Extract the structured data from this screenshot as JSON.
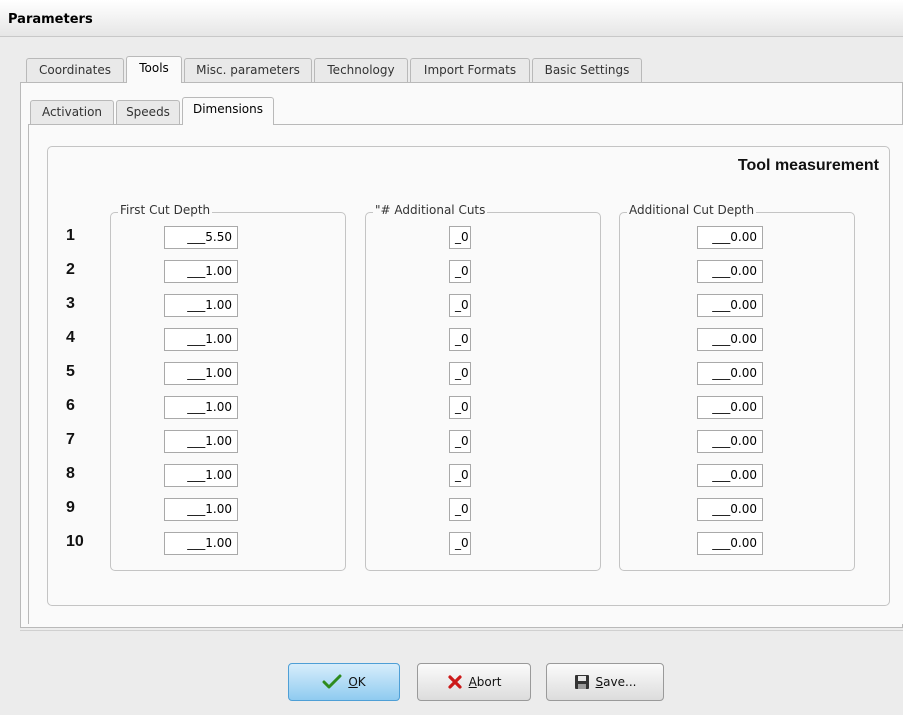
{
  "window": {
    "title": "Parameters"
  },
  "tabs": [
    {
      "label": "Coordinates"
    },
    {
      "label": "Tools"
    },
    {
      "label": "Misc. parameters"
    },
    {
      "label": "Technology"
    },
    {
      "label": "Import Formats"
    },
    {
      "label": "Basic Settings"
    }
  ],
  "subtabs": [
    {
      "label": "Activation"
    },
    {
      "label": "Speeds"
    },
    {
      "label": "Dimensions"
    }
  ],
  "section": {
    "heading": "Tool measurement"
  },
  "columns": [
    {
      "label": "First Cut Depth"
    },
    {
      "label": "\"# Additional Cuts"
    },
    {
      "label": "Additional Cut Depth"
    }
  ],
  "rows": [
    {
      "num": "1",
      "first_cut_depth": "___5.50",
      "additional_cuts": "_0",
      "additional_cut_depth": "___0.00"
    },
    {
      "num": "2",
      "first_cut_depth": "___1.00",
      "additional_cuts": "_0",
      "additional_cut_depth": "___0.00"
    },
    {
      "num": "3",
      "first_cut_depth": "___1.00",
      "additional_cuts": "_0",
      "additional_cut_depth": "___0.00"
    },
    {
      "num": "4",
      "first_cut_depth": "___1.00",
      "additional_cuts": "_0",
      "additional_cut_depth": "___0.00"
    },
    {
      "num": "5",
      "first_cut_depth": "___1.00",
      "additional_cuts": "_0",
      "additional_cut_depth": "___0.00"
    },
    {
      "num": "6",
      "first_cut_depth": "___1.00",
      "additional_cuts": "_0",
      "additional_cut_depth": "___0.00"
    },
    {
      "num": "7",
      "first_cut_depth": "___1.00",
      "additional_cuts": "_0",
      "additional_cut_depth": "___0.00"
    },
    {
      "num": "8",
      "first_cut_depth": "___1.00",
      "additional_cuts": "_0",
      "additional_cut_depth": "___0.00"
    },
    {
      "num": "9",
      "first_cut_depth": "___1.00",
      "additional_cuts": "_0",
      "additional_cut_depth": "___0.00"
    },
    {
      "num": "10",
      "first_cut_depth": "___1.00",
      "additional_cuts": "_0",
      "additional_cut_depth": "___0.00"
    }
  ],
  "buttons": {
    "ok": {
      "mnemonic": "O",
      "rest": "K",
      "icon": "checkmark-icon"
    },
    "abort": {
      "mnemonic": "A",
      "rest": "bort",
      "icon": "x-icon"
    },
    "save": {
      "mnemonic": "S",
      "rest": "ave...",
      "icon": "floppy-disk-icon"
    }
  },
  "colors": {
    "ok_accent": "#8fcbf0",
    "check": "#2e8b1e",
    "abort_x": "#cc1a1a"
  }
}
